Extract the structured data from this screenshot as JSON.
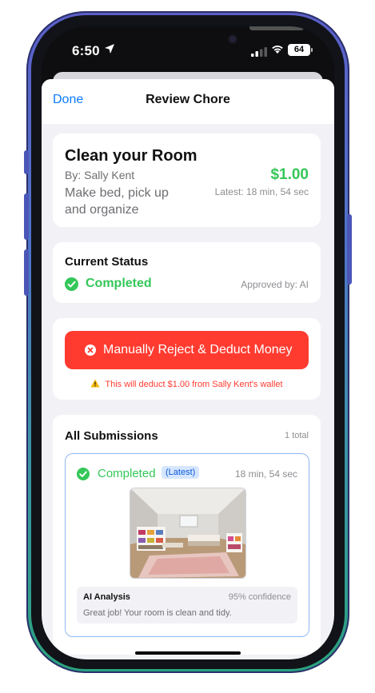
{
  "status_bar": {
    "time": "6:50",
    "battery": "64"
  },
  "nav": {
    "done_label": "Done",
    "title": "Review Chore"
  },
  "chore": {
    "title": "Clean your Room",
    "by": "By: Sally Kent",
    "description": "Make bed, pick up and organize",
    "reward": "$1.00",
    "latest": "Latest: 18 min, 54 sec"
  },
  "status": {
    "heading": "Current Status",
    "value": "Completed",
    "approved_by": "Approved by: AI",
    "color": "#34c759"
  },
  "reject": {
    "button_label": "Manually Reject & Deduct Money",
    "warning": "This will deduct $1.00 from Sally Kent's wallet",
    "color": "#ff3b30"
  },
  "submissions": {
    "heading": "All Submissions",
    "total": "1 total",
    "items": [
      {
        "status": "Completed",
        "badge": "(Latest)",
        "time": "18 min, 54 sec",
        "image": "kids-bedroom-photo",
        "ai_title": "AI Analysis",
        "ai_confidence": "95% confidence",
        "ai_text": "Great job! Your room is clean and tidy."
      }
    ]
  },
  "icons": [
    "location-arrow-icon",
    "signal-icon",
    "wifi-icon",
    "battery-icon",
    "checkmark-circle-icon",
    "x-circle-icon",
    "warning-icon"
  ],
  "colors": {
    "accent": "#0a7aff",
    "success": "#34c759",
    "danger": "#ff3b30"
  }
}
